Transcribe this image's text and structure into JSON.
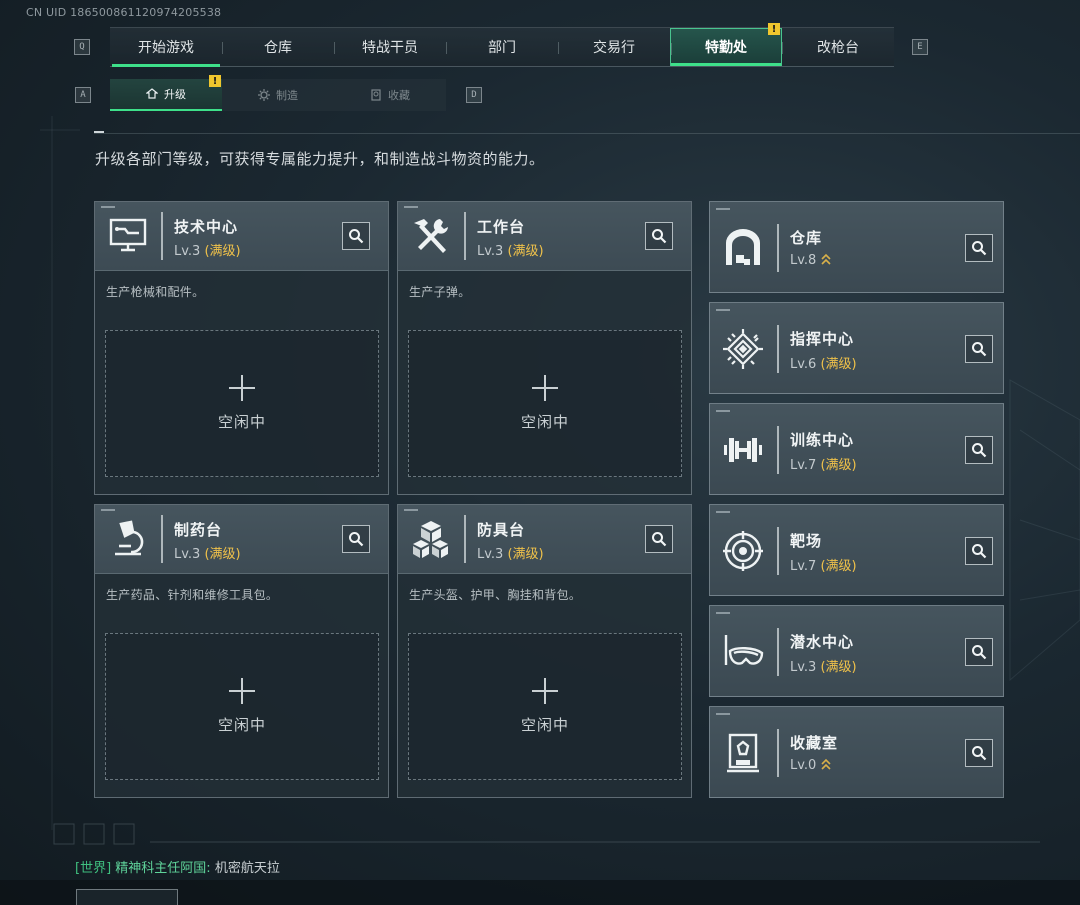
{
  "uid_text": "CN UID 1865008611209742055​38",
  "top_tabs": [
    {
      "label": "开始游戏",
      "state": "underline"
    },
    {
      "label": "仓库",
      "state": "normal"
    },
    {
      "label": "特战干员",
      "state": "normal"
    },
    {
      "label": "部门",
      "state": "normal"
    },
    {
      "label": "交易行",
      "state": "normal"
    },
    {
      "label": "特勤处",
      "state": "active",
      "alert": "!"
    },
    {
      "label": "改枪台",
      "state": "normal"
    }
  ],
  "top_keys": {
    "left": "Q",
    "right": "E"
  },
  "sub_tabs": [
    {
      "label": "升级",
      "icon": "upgrade-icon",
      "active": true,
      "alert": "!"
    },
    {
      "label": "制造",
      "icon": "gear-icon",
      "active": false
    },
    {
      "label": "收藏",
      "icon": "trophy-icon",
      "active": false
    }
  ],
  "sub_keys": {
    "left": "A",
    "right": "D"
  },
  "description": "升级各部门等级，可获得专属能力提升，和制造战斗物资的能力。",
  "production_cards": [
    {
      "name": "技术中心",
      "icon": "computer-icon",
      "level": "Lv.3",
      "max": "(满级)",
      "desc": "生产枪械和配件。",
      "slot": "空闲中"
    },
    {
      "name": "工作台",
      "icon": "tools-icon",
      "level": "Lv.3",
      "max": "(满级)",
      "desc": "生产子弹。",
      "slot": "空闲中"
    },
    {
      "name": "制药台",
      "icon": "microscope-icon",
      "level": "Lv.3",
      "max": "(满级)",
      "desc": "生产药品、针剂和维修工具包。",
      "slot": "空闲中"
    },
    {
      "name": "防具台",
      "icon": "cubes-icon",
      "level": "Lv.3",
      "max": "(满级)",
      "desc": "生产头盔、护甲、胸挂和背包。",
      "slot": "空闲中"
    }
  ],
  "facility_cards": [
    {
      "name": "仓库",
      "icon": "warehouse-icon",
      "level": "Lv.8",
      "max": "",
      "upgradable": true
    },
    {
      "name": "指挥中心",
      "icon": "chip-icon",
      "level": "Lv.6",
      "max": "(满级)",
      "upgradable": false
    },
    {
      "name": "训练中心",
      "icon": "dumbbell-icon",
      "level": "Lv.7",
      "max": "(满级)",
      "upgradable": false
    },
    {
      "name": "靶场",
      "icon": "target-icon",
      "level": "Lv.7",
      "max": "(满级)",
      "upgradable": false
    },
    {
      "name": "潜水中心",
      "icon": "diving-mask-icon",
      "level": "Lv.3",
      "max": "(满级)",
      "upgradable": false
    },
    {
      "name": "收藏室",
      "icon": "trophy-case-icon",
      "level": "Lv.0",
      "max": "",
      "upgradable": true
    }
  ],
  "chat": {
    "channel": "[世界]",
    "sender": "精神科主任阿国:",
    "message": "机密航天拉"
  },
  "colors": {
    "accent": "#3ee08a",
    "max_level": "#f0c24a",
    "alert": "#f0c62e"
  }
}
